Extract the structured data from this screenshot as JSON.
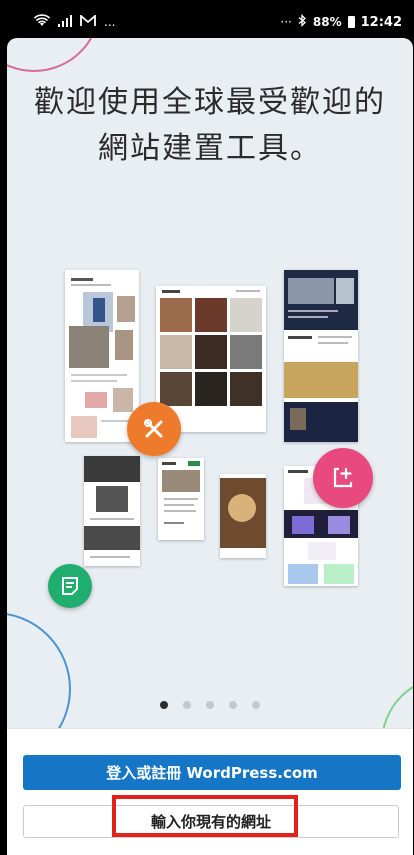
{
  "status_bar": {
    "left_icons": [
      "wifi-icon",
      "signal-icon",
      "gmail-icon"
    ],
    "left_more": "...",
    "right_more": "···",
    "battery": "88%",
    "time": "12:42"
  },
  "onboarding": {
    "title_line1": "歡迎使用全球最受歡迎的",
    "title_line2": "網站建置工具。",
    "illustration_icons": [
      "tools-icon",
      "add-page-icon",
      "document-icon"
    ],
    "page_indicator": {
      "total": 5,
      "active_index": 0
    }
  },
  "actions": {
    "primary_label": "登入或註冊 WordPress.com",
    "secondary_label": "輸入你現有的網址"
  },
  "colors": {
    "primary": "#1576c6",
    "tools_fab": "#ee7a2b",
    "add_fab": "#e84a7f",
    "doc_fab": "#1fae6e",
    "highlight": "#e3221c"
  }
}
